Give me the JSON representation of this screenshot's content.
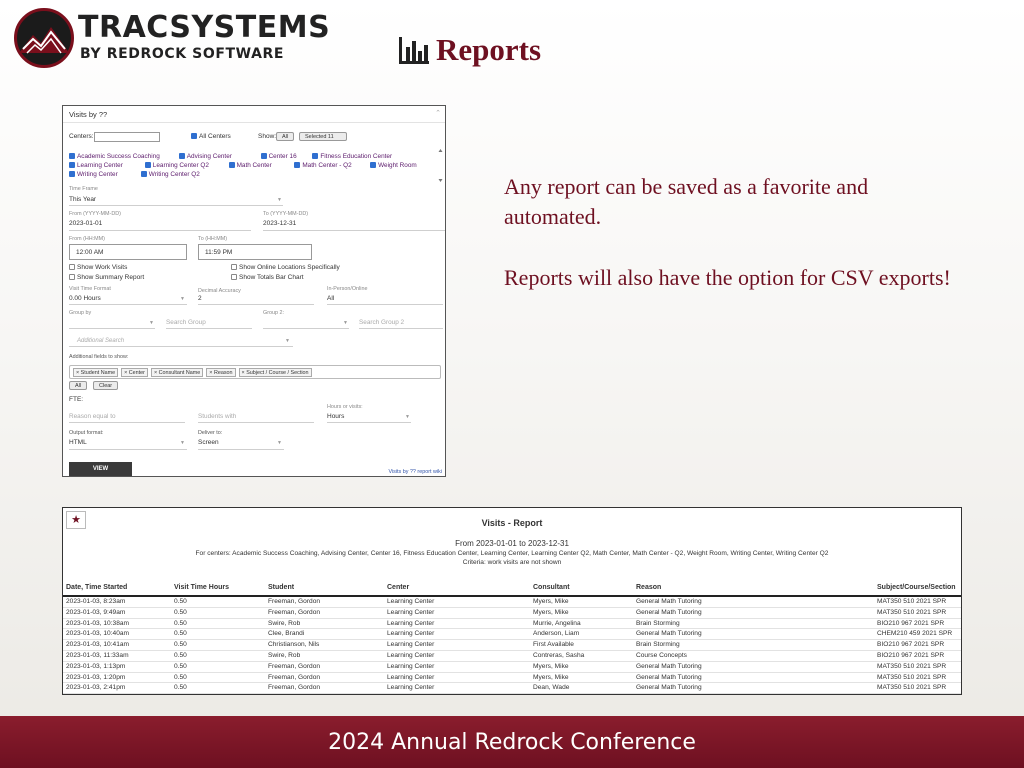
{
  "header": {
    "logo_line1": "TRACSYSTEMS",
    "logo_line2": "BY REDROCK SOFTWARE",
    "page_title": "Reports",
    "page_title_icon": "bar-chart-icon",
    "accent_color": "#6e1021"
  },
  "side_text": {
    "para1": "Any report can be saved as a favorite and automated.",
    "para2": "Reports will also have the option for CSV exports!"
  },
  "form": {
    "title": "Visits by ??",
    "centers_label": "Centers:",
    "all_centers_label": "All Centers",
    "show_label": "Show:",
    "show_all_button": "All",
    "show_selected_button": "Selected 11",
    "centers": [
      "Academic Success Coaching",
      "Advising Center",
      "Center 16",
      "Fitness Education Center",
      "Learning Center",
      "Learning Center Q2",
      "Math Center",
      "Math Center - Q2",
      "Weight Room",
      "Writing Center",
      "Writing Center Q2"
    ],
    "time_frame_label": "Time Frame",
    "time_frame_value": "This Year",
    "from_date_label": "From (YYYY-MM-DD)",
    "from_date_value": "2023-01-01",
    "to_date_label": "To (YYYY-MM-DD)",
    "to_date_value": "2023-12-31",
    "from_time_label": "From (HH:MM)",
    "from_time_value": "12:00 AM",
    "to_time_label": "To (HH:MM)",
    "to_time_value": "11:59 PM",
    "show_work_visits": "Show Work Visits",
    "show_summary_report": "Show Summary Report",
    "show_online_locations": "Show Online Locations Specifically",
    "show_totals_bar_chart": "Show Totals Bar Chart",
    "visit_time_format_label": "Visit Time Format",
    "visit_time_format_value": "0.00 Hours",
    "decimal_accuracy_label": "Decimal Accuracy",
    "decimal_accuracy_value": "2",
    "in_person_online_label": "In-Person/Online",
    "in_person_online_value": "All",
    "group_by_label": "Group by",
    "search_group_placeholder": "Search Group",
    "group2_label": "Group 2:",
    "search_group2_placeholder": "Search Group 2",
    "additional_search_placeholder": "Additional Search",
    "additional_fields_label": "Additional fields to show:",
    "additional_fields": [
      "Student Name",
      "Center",
      "Consultant Name",
      "Reason",
      "Subject / Course / Section"
    ],
    "fields_all_button": "All",
    "fields_clear_button": "Clear",
    "fte_label": "FTE:",
    "reason_equal_placeholder": "Reason equal to",
    "students_with_placeholder": "Students with",
    "hours_or_visits_label": "Hours or visits:",
    "hours_or_visits_value": "Hours",
    "output_format_label": "Output format:",
    "output_format_value": "HTML",
    "deliver_to_label": "Deliver to:",
    "deliver_to_value": "Screen",
    "view_button": "VIEW",
    "wiki_link": "Visits by ?? report wiki"
  },
  "report": {
    "title": "Visits - Report",
    "range": "From 2023-01-01 to 2023-12-31",
    "centers_line": "For centers: Academic Success Coaching, Advising Center, Center 16, Fitness Education Center, Learning Center, Learning Center Q2, Math Center, Math Center - Q2, Weight Room, Writing Center, Writing Center Q2",
    "criteria_line": "Criteria: work visits are not shown",
    "columns": [
      "Date, Time Started",
      "Visit Time Hours",
      "Student",
      "Center",
      "Consultant",
      "Reason",
      "Subject/Course/Section"
    ],
    "rows": [
      [
        "2023-01-03, 8:23am",
        "0.50",
        "Freeman, Gordon",
        "Learning Center",
        "Myers, Mike",
        "General Math Tutoring",
        "MAT350 510 2021 SPR"
      ],
      [
        "2023-01-03, 9:49am",
        "0.50",
        "Freeman, Gordon",
        "Learning Center",
        "Myers, Mike",
        "General Math Tutoring",
        "MAT350 510 2021 SPR"
      ],
      [
        "2023-01-03, 10:38am",
        "0.50",
        "Swire, Rob",
        "Learning Center",
        "Murrie, Angelina",
        "Brain Storming",
        "BIO210 967 2021 SPR"
      ],
      [
        "2023-01-03, 10:40am",
        "0.50",
        "Clee, Brandi",
        "Learning Center",
        "Anderson, Liam",
        "General Math Tutoring",
        "CHEM210 459 2021 SPR"
      ],
      [
        "2023-01-03, 10:41am",
        "0.50",
        "Christianson, Nils",
        "Learning Center",
        "First Available",
        "Brain Storming",
        "BIO210 967 2021 SPR"
      ],
      [
        "2023-01-03, 11:33am",
        "0.50",
        "Swire, Rob",
        "Learning Center",
        "Contreras, Sasha",
        "Course Concepts",
        "BIO210 967 2021 SPR"
      ],
      [
        "2023-01-03, 1:13pm",
        "0.50",
        "Freeman, Gordon",
        "Learning Center",
        "Myers, Mike",
        "General Math Tutoring",
        "MAT350 510 2021 SPR"
      ],
      [
        "2023-01-03, 1:20pm",
        "0.50",
        "Freeman, Gordon",
        "Learning Center",
        "Myers, Mike",
        "General Math Tutoring",
        "MAT350 510 2021 SPR"
      ],
      [
        "2023-01-03, 2:41pm",
        "0.50",
        "Freeman, Gordon",
        "Learning Center",
        "Dean, Wade",
        "General Math Tutoring",
        "MAT350 510 2021 SPR"
      ]
    ]
  },
  "footer": {
    "text": "2024 Annual Redrock Conference"
  }
}
